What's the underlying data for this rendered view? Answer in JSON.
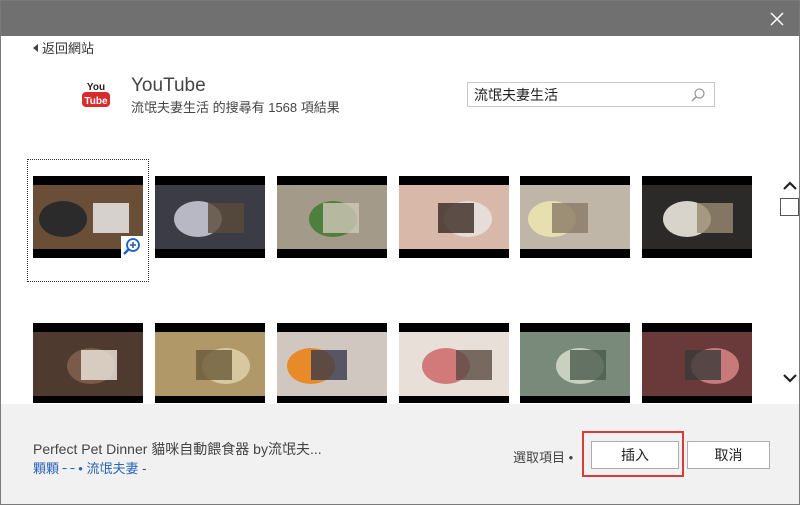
{
  "nav": {
    "back_label": "返回網站"
  },
  "source": {
    "title": "YouTube",
    "logo_text": "You Tube",
    "result_summary": "流氓夫妻生活 的搜尋有 1568 項結果"
  },
  "search": {
    "value": "流氓夫妻生活"
  },
  "selection": {
    "title": "Perfect Pet Dinner 貓咪自動餵食器 by流氓夫...",
    "meta_prefix": "顆顆 ╴╴•",
    "channel": "流氓夫妻",
    "meta_suffix": "-",
    "count_label": "選取項目 •"
  },
  "buttons": {
    "insert": "插入",
    "cancel": "取消"
  },
  "icons": {
    "close": "close-icon",
    "back": "triangle-left-icon",
    "search": "search-icon",
    "zoom": "zoom-in-icon",
    "scroll_up": "chevron-up-icon",
    "scroll_down": "chevron-down-icon"
  },
  "thumbnails": [
    {
      "name": "pet-feeder",
      "colors": [
        "#6a4e38",
        "#2b2b2b",
        "#f2f2f2"
      ]
    },
    {
      "name": "cat-computer-room",
      "colors": [
        "#3c3c46",
        "#b8b8c4",
        "#5a4a3a"
      ]
    },
    {
      "name": "cats-on-floor",
      "colors": [
        "#a39a8a",
        "#4f7f3c",
        "#d0c8b8"
      ]
    },
    {
      "name": "woman-face",
      "colors": [
        "#d8b8a8",
        "#e6ddd6",
        "#3a2a22"
      ]
    },
    {
      "name": "hand-paper",
      "colors": [
        "#c0b6a8",
        "#e8dfb0",
        "#8a7a66"
      ]
    },
    {
      "name": "craft-hands",
      "colors": [
        "#2b2a28",
        "#d8d4cc",
        "#9a8a70"
      ]
    },
    {
      "name": "cooking-bowl",
      "colors": [
        "#4e3a2e",
        "#7a5a48",
        "#f0e8e0"
      ]
    },
    {
      "name": "soup-pot",
      "colors": [
        "#b09868",
        "#d8c8a0",
        "#6a5a3a"
      ]
    },
    {
      "name": "orange-food-pot",
      "colors": [
        "#d0c8c0",
        "#e88a2a",
        "#3a3a4a"
      ]
    },
    {
      "name": "face-mask",
      "colors": [
        "#e8e0d8",
        "#d27a7a",
        "#5a4a42"
      ]
    },
    {
      "name": "green-plate",
      "colors": [
        "#7a8a7a",
        "#c8d0c0",
        "#4a5a4a"
      ]
    },
    {
      "name": "meat-pot",
      "colors": [
        "#6a3a3a",
        "#c87a7a",
        "#3a3a3a"
      ]
    }
  ],
  "colors": {
    "highlight": "#d93b3b",
    "link": "#2a64b8",
    "youtube_red": "#d92b2b",
    "titlebar": "#707070"
  }
}
